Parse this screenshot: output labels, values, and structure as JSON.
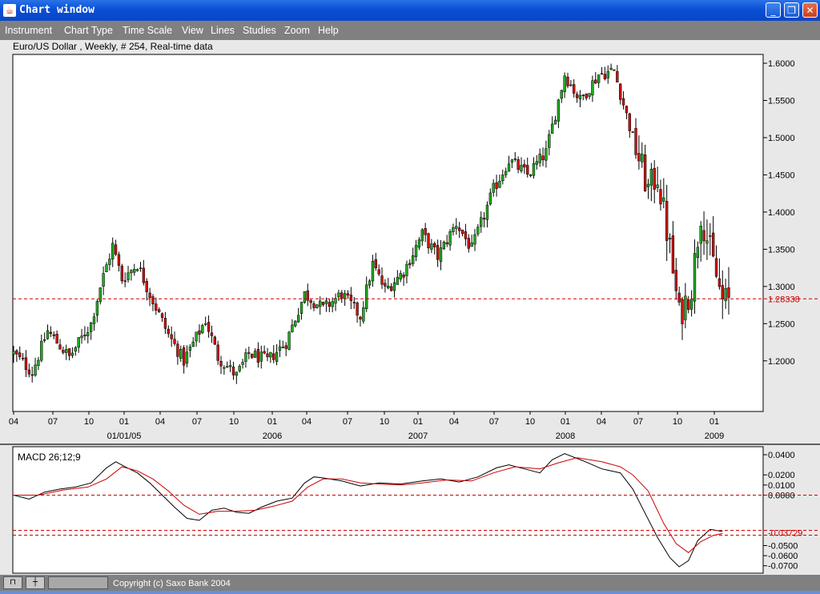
{
  "window": {
    "title": "Chart window",
    "buttons": [
      "minimize",
      "restore",
      "close"
    ]
  },
  "menu": [
    "Instrument",
    "Chart Type",
    "Time Scale",
    "View",
    "Lines",
    "Studies",
    "Zoom",
    "Help"
  ],
  "chart_header": "Euro/US Dollar , Weekly, # 254, Real-time data",
  "status": {
    "copyright": "Copyright (c) Saxo Bank 2004"
  },
  "colors": {
    "up": "#22aa22",
    "down": "#cc1111",
    "level": "#cc0000",
    "macd": "#000000",
    "signal": "#cc0000"
  },
  "chart_data": [
    {
      "type": "candlestick",
      "title": "Euro/US Dollar , Weekly, # 254, Real-time data",
      "x_ticks": [
        "04",
        "07",
        "10",
        "01",
        "04",
        "07",
        "10",
        "01",
        "04",
        "07",
        "10",
        "01",
        "04",
        "07",
        "10",
        "01",
        "04",
        "07",
        "10",
        "01"
      ],
      "x_year_labels": [
        "01/01/05",
        "2006",
        "2007",
        "2008",
        "2009"
      ],
      "y_ticks": [
        "1.6000",
        "1.5500",
        "1.5000",
        "1.4500",
        "1.4000",
        "1.3500",
        "1.3000",
        "1.2500",
        "1.2000"
      ],
      "ylim": [
        1.16,
        1.61
      ],
      "current_level": {
        "value": 1.28338,
        "label": "1.28338"
      },
      "anchors_close": [
        [
          0,
          1.21
        ],
        [
          6,
          1.185
        ],
        [
          11,
          1.24
        ],
        [
          18,
          1.205
        ],
        [
          25,
          1.25
        ],
        [
          28,
          1.3
        ],
        [
          32,
          1.355
        ],
        [
          35,
          1.31
        ],
        [
          40,
          1.33
        ],
        [
          44,
          1.29
        ],
        [
          50,
          1.235
        ],
        [
          55,
          1.2
        ],
        [
          62,
          1.255
        ],
        [
          66,
          1.205
        ],
        [
          72,
          1.18
        ],
        [
          76,
          1.21
        ],
        [
          82,
          1.2
        ],
        [
          88,
          1.225
        ],
        [
          94,
          1.29
        ],
        [
          100,
          1.27
        ],
        [
          106,
          1.29
        ],
        [
          112,
          1.26
        ],
        [
          116,
          1.33
        ],
        [
          120,
          1.295
        ],
        [
          126,
          1.32
        ],
        [
          132,
          1.37
        ],
        [
          137,
          1.34
        ],
        [
          143,
          1.385
        ],
        [
          148,
          1.35
        ],
        [
          155,
          1.43
        ],
        [
          160,
          1.47
        ],
        [
          166,
          1.45
        ],
        [
          172,
          1.48
        ],
        [
          178,
          1.585
        ],
        [
          183,
          1.55
        ],
        [
          189,
          1.585
        ],
        [
          194,
          1.59
        ],
        [
          200,
          1.5
        ],
        [
          205,
          1.43
        ],
        [
          208,
          1.45
        ],
        [
          212,
          1.35
        ],
        [
          215,
          1.26
        ],
        [
          219,
          1.3
        ],
        [
          222,
          1.4
        ],
        [
          226,
          1.33
        ],
        [
          229,
          1.28
        ]
      ],
      "legend": []
    },
    {
      "type": "line",
      "title": "MACD 26;12;9",
      "y_ticks": [
        "0.0400",
        "0.0200",
        "0.0100",
        "0.0000",
        "-0.0500",
        "-0.0600",
        "-0.0700"
      ],
      "ylim": [
        -0.073,
        0.041
      ],
      "current_level": {
        "value": -0.03729,
        "label": "-0.03729"
      },
      "series": [
        {
          "name": "",
          "color": "#000000",
          "values": [
            [
              0,
              0.0
            ],
            [
              5,
              -0.004
            ],
            [
              10,
              0.003
            ],
            [
              15,
              0.006
            ],
            [
              20,
              0.008
            ],
            [
              25,
              0.012
            ],
            [
              30,
              0.027
            ],
            [
              33,
              0.033
            ],
            [
              36,
              0.028
            ],
            [
              40,
              0.022
            ],
            [
              44,
              0.012
            ],
            [
              48,
              0.0
            ],
            [
              52,
              -0.012
            ],
            [
              56,
              -0.023
            ],
            [
              60,
              -0.025
            ],
            [
              64,
              -0.015
            ],
            [
              68,
              -0.013
            ],
            [
              72,
              -0.017
            ],
            [
              76,
              -0.018
            ],
            [
              80,
              -0.012
            ],
            [
              85,
              -0.006
            ],
            [
              90,
              -0.003
            ],
            [
              94,
              0.012
            ],
            [
              97,
              0.018
            ],
            [
              100,
              0.017
            ],
            [
              106,
              0.014
            ],
            [
              112,
              0.009
            ],
            [
              118,
              0.012
            ],
            [
              125,
              0.011
            ],
            [
              132,
              0.014
            ],
            [
              138,
              0.016
            ],
            [
              144,
              0.013
            ],
            [
              150,
              0.018
            ],
            [
              156,
              0.027
            ],
            [
              160,
              0.03
            ],
            [
              165,
              0.026
            ],
            [
              170,
              0.022
            ],
            [
              174,
              0.035
            ],
            [
              178,
              0.041
            ],
            [
              184,
              0.034
            ],
            [
              190,
              0.026
            ],
            [
              196,
              0.022
            ],
            [
              200,
              0.006
            ],
            [
              204,
              -0.018
            ],
            [
              208,
              -0.042
            ],
            [
              212,
              -0.062
            ],
            [
              215,
              -0.071
            ],
            [
              218,
              -0.065
            ],
            [
              221,
              -0.045
            ],
            [
              225,
              -0.034
            ],
            [
              229,
              -0.036
            ]
          ]
        },
        {
          "name": "",
          "color": "#cc0000",
          "values": [
            [
              0,
              0.0
            ],
            [
              8,
              0.0
            ],
            [
              16,
              0.005
            ],
            [
              24,
              0.008
            ],
            [
              30,
              0.016
            ],
            [
              35,
              0.028
            ],
            [
              40,
              0.024
            ],
            [
              45,
              0.016
            ],
            [
              50,
              0.004
            ],
            [
              55,
              -0.01
            ],
            [
              60,
              -0.019
            ],
            [
              66,
              -0.016
            ],
            [
              72,
              -0.016
            ],
            [
              78,
              -0.015
            ],
            [
              84,
              -0.011
            ],
            [
              90,
              -0.006
            ],
            [
              95,
              0.008
            ],
            [
              100,
              0.016
            ],
            [
              106,
              0.016
            ],
            [
              112,
              0.012
            ],
            [
              118,
              0.011
            ],
            [
              125,
              0.01
            ],
            [
              132,
              0.012
            ],
            [
              140,
              0.015
            ],
            [
              148,
              0.014
            ],
            [
              155,
              0.022
            ],
            [
              162,
              0.028
            ],
            [
              170,
              0.026
            ],
            [
              176,
              0.032
            ],
            [
              182,
              0.037
            ],
            [
              190,
              0.033
            ],
            [
              196,
              0.028
            ],
            [
              200,
              0.02
            ],
            [
              205,
              0.004
            ],
            [
              210,
              -0.028
            ],
            [
              214,
              -0.048
            ],
            [
              218,
              -0.057
            ],
            [
              222,
              -0.046
            ],
            [
              226,
              -0.04
            ],
            [
              229,
              -0.038
            ]
          ]
        }
      ],
      "legend": []
    }
  ]
}
